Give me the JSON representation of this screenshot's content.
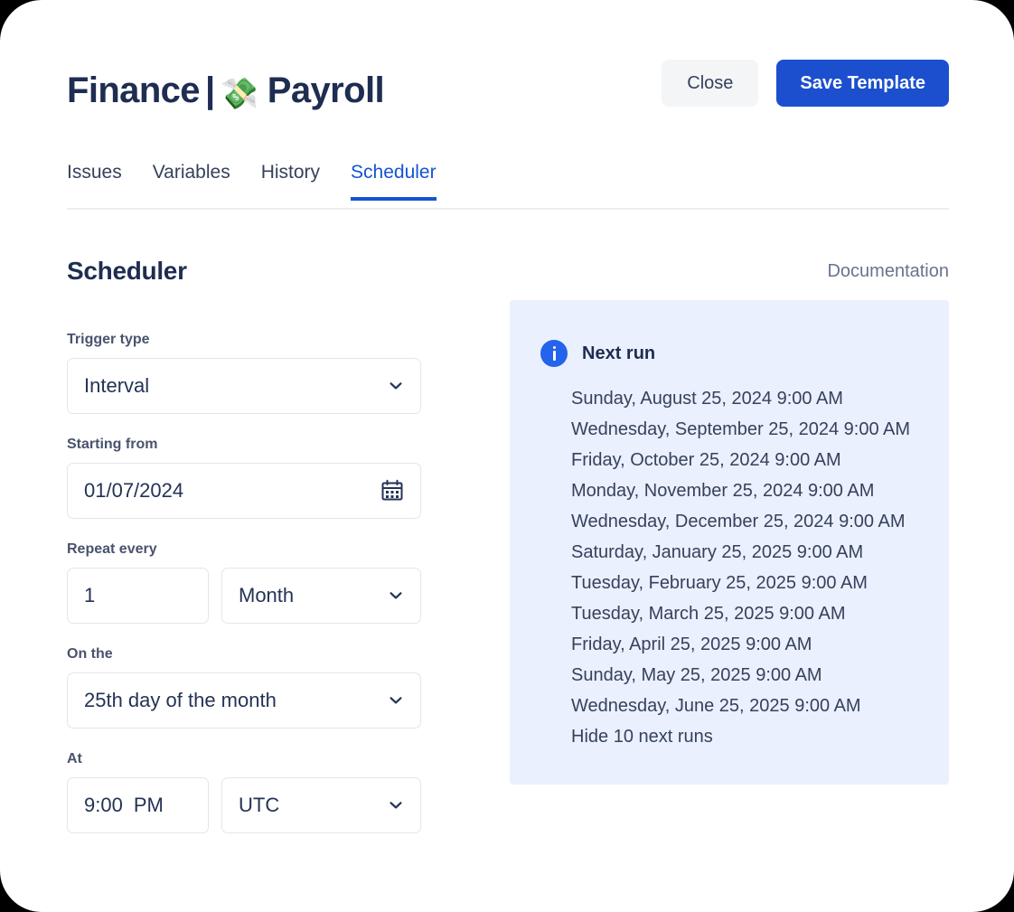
{
  "header": {
    "title_left": "Finance",
    "title_separator": "|",
    "title_emoji": "💸",
    "title_right": "Payroll",
    "close_label": "Close",
    "save_label": "Save Template"
  },
  "tabs": [
    {
      "label": "Issues",
      "active": false
    },
    {
      "label": "Variables",
      "active": false
    },
    {
      "label": "History",
      "active": false
    },
    {
      "label": "Scheduler",
      "active": true
    }
  ],
  "section": {
    "title": "Scheduler",
    "documentation_label": "Documentation"
  },
  "form": {
    "trigger_type": {
      "label": "Trigger type",
      "value": "Interval"
    },
    "starting_from": {
      "label": "Starting from",
      "value": "01/07/2024",
      "icon": "calendar-icon"
    },
    "repeat_every": {
      "label": "Repeat every",
      "count": "1",
      "unit": "Month"
    },
    "on_the": {
      "label": "On the",
      "value": "25th day of the month"
    },
    "at": {
      "label": "At",
      "time": "9:00",
      "meridiem": "PM",
      "timezone": "UTC"
    }
  },
  "info_panel": {
    "icon": "info-icon",
    "title": "Next run",
    "runs": [
      "Sunday, August 25, 2024 9:00 AM",
      "Wednesday, September 25, 2024 9:00 AM",
      "Friday, October 25, 2024 9:00 AM",
      "Monday, November 25, 2024 9:00 AM",
      "Wednesday, December 25, 2024 9:00 AM",
      "Saturday, January 25, 2025 9:00 AM",
      "Tuesday, February 25, 2025 9:00 AM",
      "Tuesday, March 25, 2025 9:00 AM",
      "Friday, April 25, 2025 9:00 AM",
      "Sunday, May 25, 2025 9:00 AM",
      "Wednesday, June 25, 2025 9:00 AM"
    ],
    "toggle_label": "Hide 10 next runs"
  },
  "colors": {
    "accent_blue": "#1355d4",
    "primary_button": "#1b4fce",
    "info_panel_bg": "#eaf0fd",
    "info_icon": "#2463eb",
    "text_dark": "#1e2d51",
    "text_body": "#36415c",
    "border": "#e3e6eb"
  }
}
